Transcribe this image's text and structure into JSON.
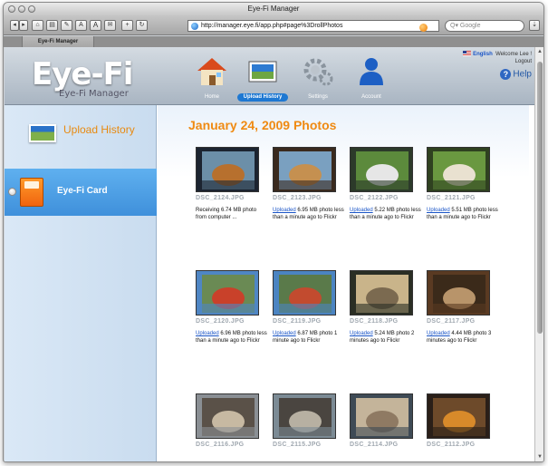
{
  "window": {
    "title": "Eye-Fi Manager"
  },
  "toolbar": {
    "url": "http://manager.eye.fi/app.php#page%3DrollPhotos",
    "search_placeholder": "Q▾ Google",
    "text_small": "A",
    "text_large": "A"
  },
  "tab": {
    "label": "Eye-Fi Manager"
  },
  "app": {
    "logo": "Eye-Fi",
    "logo_sub": "Eye-Fi Manager",
    "nav": [
      {
        "label": "Home",
        "icon": "house-icon"
      },
      {
        "label": "Upload History",
        "icon": "photo-icon"
      },
      {
        "label": "Settings",
        "icon": "gears-icon"
      },
      {
        "label": "Account",
        "icon": "person-icon"
      }
    ],
    "language": "English",
    "welcome": "Welcome Lee !",
    "logout": "Logout",
    "help": "Help"
  },
  "sidebar": {
    "upload_history": "Upload History",
    "card": "Eye-Fi Card"
  },
  "content": {
    "title": "January 24, 2009 Photos",
    "photos": [
      {
        "name": "DSC_2124.JPG",
        "link": "",
        "text": "Receiving 6.74 MB photo from computer ..."
      },
      {
        "name": "DSC_2123.JPG",
        "link": "Uploaded",
        "text": " 6.95 MB photo less than a minute ago to Flickr"
      },
      {
        "name": "DSC_2122.JPG",
        "link": "Uploaded",
        "text": " 5.22 MB photo less than a minute ago to Flickr"
      },
      {
        "name": "DSC_2121.JPG",
        "link": "Uploaded",
        "text": " 5.51 MB photo less than a minute ago to Flickr"
      },
      {
        "name": "DSC_2120.JPG",
        "link": "Uploaded",
        "text": " 6.96 MB photo less than a minute ago to Flickr"
      },
      {
        "name": "DSC_2119.JPG",
        "link": "Uploaded",
        "text": " 6.87 MB photo 1 minute ago to Flickr"
      },
      {
        "name": "DSC_2118.JPG",
        "link": "Uploaded",
        "text": " 5.24 MB photo 2 minutes ago to Flickr"
      },
      {
        "name": "DSC_2117.JPG",
        "link": "Uploaded",
        "text": " 4.44 MB photo 3 minutes ago to Flickr"
      },
      {
        "name": "DSC_2116.JPG",
        "link": "",
        "text": ""
      },
      {
        "name": "DSC_2115.JPG",
        "link": "",
        "text": ""
      },
      {
        "name": "DSC_2114.JPG",
        "link": "",
        "text": ""
      },
      {
        "name": "DSC_2112.JPG",
        "link": "",
        "text": ""
      }
    ]
  },
  "colors": {
    "accent_orange": "#ef8a12",
    "sidebar_selected": "#4a9be2",
    "link_blue": "#1a55c7",
    "nav_active": "#1e78d2"
  }
}
